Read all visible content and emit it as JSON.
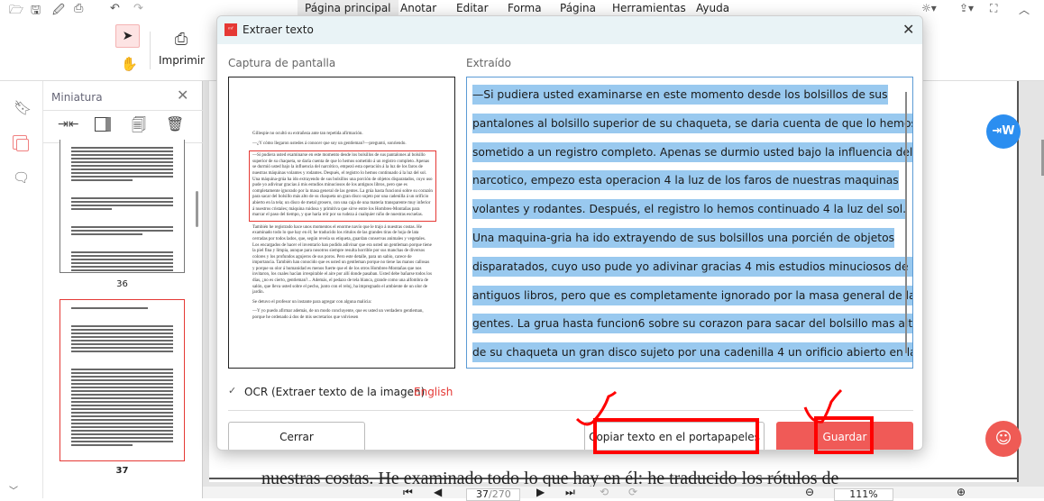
{
  "menubar": {
    "items": [
      "Página principal",
      "Anotar",
      "Editar",
      "Forma",
      "Página",
      "Herramientas",
      "Ayuda"
    ],
    "active": "Página principal"
  },
  "toolbar": {
    "print_label": "Imprimir"
  },
  "sidebar": {
    "title": "Miniatura",
    "thumbnails": [
      {
        "label": "36"
      },
      {
        "label": "37",
        "selected": true
      }
    ]
  },
  "document": {
    "visible_line": "nuestras costas. He examinado todo lo que hay en él: he traducido los rótulos de"
  },
  "statusbar": {
    "page_current": "37",
    "page_total": "/270",
    "zoom": "111%"
  },
  "dialog": {
    "title": "Extraer texto",
    "screenshot_label": "Captura de pantalla",
    "extracted_label": "Extraído",
    "screenshot_paragraphs": [
      "Gillespie no ocultó su extrañeza ante tan repetida afirmación.",
      "—¿Y cómo llegaron ustedes á conocer que soy un gentleman?—preguntó, sonriendo.",
      "—Si pudiera usted examinarse en este momento desde los bolsillos de sus pantalones al bolsillo superior de su chaqueta, se daría cuenta de que lo hemos sometido á un registro completo. Apenas se durmió usted bajo la influencia del narcótico, empezó esta operación á la luz de los faros de nuestras máquinas volantes y rodantes. Después, el registro lo hemos continuado á la luz del sol. Una máquina-grúa ha ido extrayendo de sus bolsillos una porción de objetos disparatados, cuyo uso pude yo adivinar gracias á mis estudios minuciosos de los antiguos libros, pero que es completamente ignorado por la masa general de las gentes. La grúa hasta funcionó sobre su corazón para sacar del bolsillo más alto de su chaqueta un gran disco sujeto por una cadenilla á un orificio abierto en la tela; un disco de metal grosero, con una caja de una materia transparente muy inferior á nuestros cristales; máquina ruidosa y primitiva que sirve entre los Hombres-Montañas para marcar el paso del tiempo, y que haría reír por su rudeza á cualquier niño de nuestras escuelas.",
      "También he registrado hace unos momentos el enorme navío que le trajo á nuestras costas. He examinado todo lo que hay en él; he traducido los rótulos de las grandes tiras de hoja de lata cerradas por todos lados, que, según revela su etiqueta, guardan conservas animales y vegetales. Los encargados de hacer el inventario han podido adivinar que era usted un gentleman porque tiene la piel fina y limpia, aunque para nosotros siempre resulta horrible por sus manchas de diversos colores y los profundos agujeros de sus poros. Pero este detalle, para un sabio, carece de importancia. También han conocido que es usted un gentleman porque no tiene las manos callosas y porque su olor á humanidad es menos fuerte que el de los otros Hombres-Montañas que nos invitaron, los cuales hacían irrespirable el aire por allí donde pasaban. Usted debe bañarse todos los días, ¿no es cierto, gentleman?... Además, el pedazo de tela blanca, grande como una alfombra de salón, que lleva usted sobre el pecho, junto con el reloj, ha impregnado el ambiente de un olor de jardín.",
      "Se detuvo el profesor un instante para agregar con alguna malicia:",
      "—Y yo puedo afirmar además, de un modo concluyente, que es usted un verdadero gentleman, porque he ordenado á dos de mis secretarios que volviesen"
    ],
    "extracted_lines": [
      "—Si pudiera usted examinarse en este momento desde los bolsillos de sus",
      "pantalones al bolsillo superior de su chaqueta, se daria cuenta de que lo hemos",
      "sometido a un registro completo. Apenas se durmio usted bajo la influencia del",
      "narcotico, empezo esta operacion 4 la luz de los faros de nuestras maquinas",
      "volantes y rodantes. Después, el registro lo hemos continuado 4 la luz del sol.",
      "Una maquina-gria ha ido extrayendo de sus bolsillos una porcién de objetos",
      "disparatados, cuyo uso pude yo adivinar gracias 4 mis estudios minuciosos de los",
      "antiguos libros, pero que es completamente ignorado por la masa general de las",
      "gentes. La grua hasta funcion6 sobre su corazon para sacar del bolsillo mas alto",
      "de su chaqueta un gran disco sujeto por una cadenilla 4 un orificio abierto en la"
    ],
    "ocr_label": "OCR (Extraer texto de la imagen)",
    "ocr_checked": true,
    "language": "English",
    "close_label": "Cerrar",
    "copy_label": "Copiar texto en el portapapeles",
    "save_label": "Guardar"
  },
  "colors": {
    "accent": "#f05a57",
    "selection": "#99c9ef",
    "annotation": "#ff0000",
    "convert_button": "#2b8ef0"
  }
}
